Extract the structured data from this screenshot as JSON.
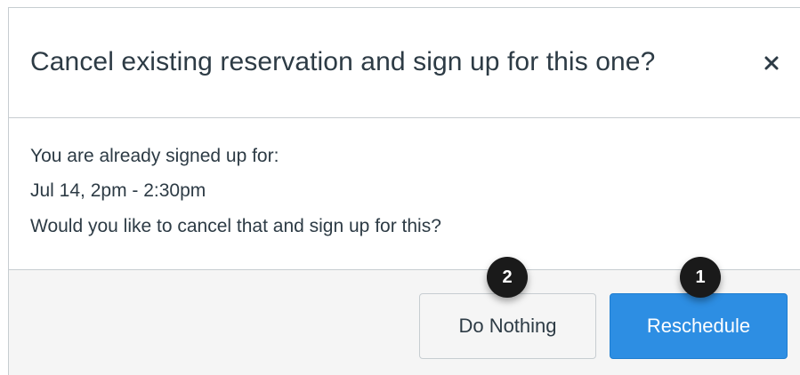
{
  "dialog": {
    "title": "Cancel existing reservation and sign up for this one?",
    "close_icon": "close-icon"
  },
  "body": {
    "line1": "You are already signed up for:",
    "line2": "Jul 14, 2pm - 2:30pm",
    "line3": "Would you like to cancel that and sign up for this?"
  },
  "footer": {
    "do_nothing_label": "Do Nothing",
    "reschedule_label": "Reschedule"
  },
  "annotations": {
    "badge_1": "1",
    "badge_2": "2"
  },
  "colors": {
    "primary": "#2d8ee3",
    "text": "#2d3b45",
    "border": "#c7cdd1",
    "footer_bg": "#f5f5f5",
    "badge_bg": "#1a1a1a"
  }
}
